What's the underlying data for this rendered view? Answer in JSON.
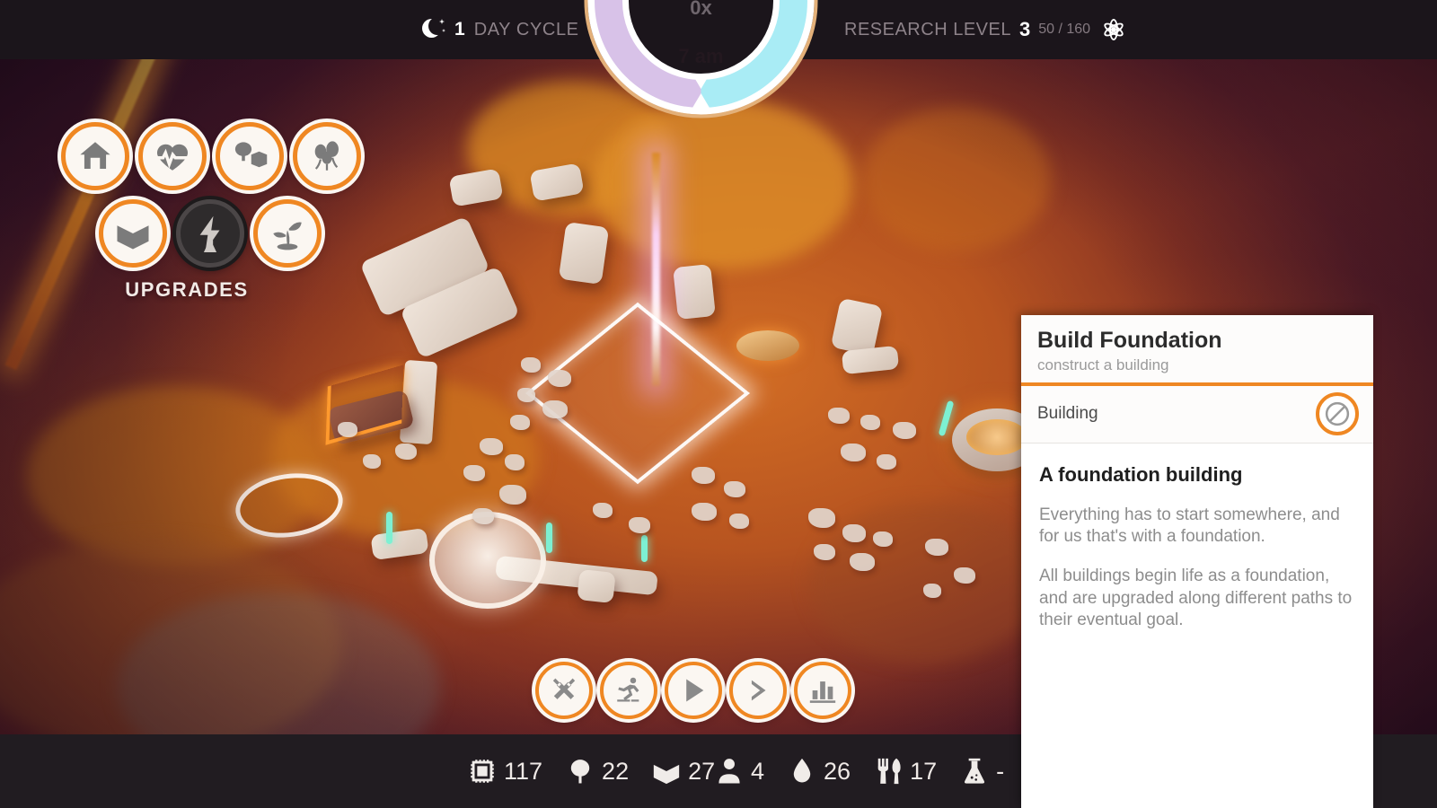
{
  "topbar": {
    "day_cycle": {
      "icon": "moon-icon",
      "count": "1",
      "label": "DAY CYCLE"
    },
    "research": {
      "label": "RESEARCH LEVEL",
      "level": "3",
      "progress": "50 / 160",
      "icon": "atom-icon"
    }
  },
  "dial": {
    "speed": "0x",
    "time": "7 am",
    "night_color": "#d8c2e8",
    "day_color": "#a9ecf5",
    "rim_color": "#e3b079"
  },
  "upgrades": {
    "label": "UPGRADES",
    "items": [
      {
        "name": "housing",
        "icon": "house-icon",
        "locked": false
      },
      {
        "name": "health",
        "icon": "heartbeat-icon",
        "locked": false
      },
      {
        "name": "resources",
        "icon": "tree-crate-icon",
        "locked": false
      },
      {
        "name": "happiness",
        "icon": "balloons-icon",
        "locked": false
      },
      {
        "name": "storage",
        "icon": "crate-icon",
        "locked": false
      },
      {
        "name": "power",
        "icon": "lightning-flask-icon",
        "locked": true
      },
      {
        "name": "farming",
        "icon": "sprout-icon",
        "locked": false
      }
    ]
  },
  "controls": [
    {
      "name": "build",
      "icon": "crossed-hammers-icon"
    },
    {
      "name": "workers",
      "icon": "running-person-icon"
    },
    {
      "name": "play",
      "icon": "play-icon"
    },
    {
      "name": "fast-forward",
      "icon": "chevron-right-icon"
    },
    {
      "name": "statistics",
      "icon": "bar-chart-icon"
    }
  ],
  "resources": {
    "left": [
      {
        "name": "components",
        "icon": "chip-icon",
        "value": "117"
      },
      {
        "name": "wood",
        "icon": "tree-icon",
        "value": "22"
      },
      {
        "name": "crates",
        "icon": "crate-icon",
        "value": "27"
      }
    ],
    "right": [
      {
        "name": "population",
        "icon": "person-icon",
        "value": "4"
      },
      {
        "name": "water",
        "icon": "droplet-icon",
        "value": "26"
      },
      {
        "name": "food",
        "icon": "cutlery-icon",
        "value": "17"
      },
      {
        "name": "research",
        "icon": "flask-icon",
        "value": "-"
      }
    ]
  },
  "panel": {
    "title": "Build Foundation",
    "subtitle": "construct a building",
    "accent_color": "#ef8722",
    "row": {
      "label": "Building",
      "icon": "no-entry-icon"
    },
    "body_heading": "A foundation building",
    "paragraph_1": "Everything has to start somewhere, and for us that's with a foundation.",
    "paragraph_2": "All buildings begin life as a foundation, and are upgraded along different paths to their eventual goal."
  }
}
